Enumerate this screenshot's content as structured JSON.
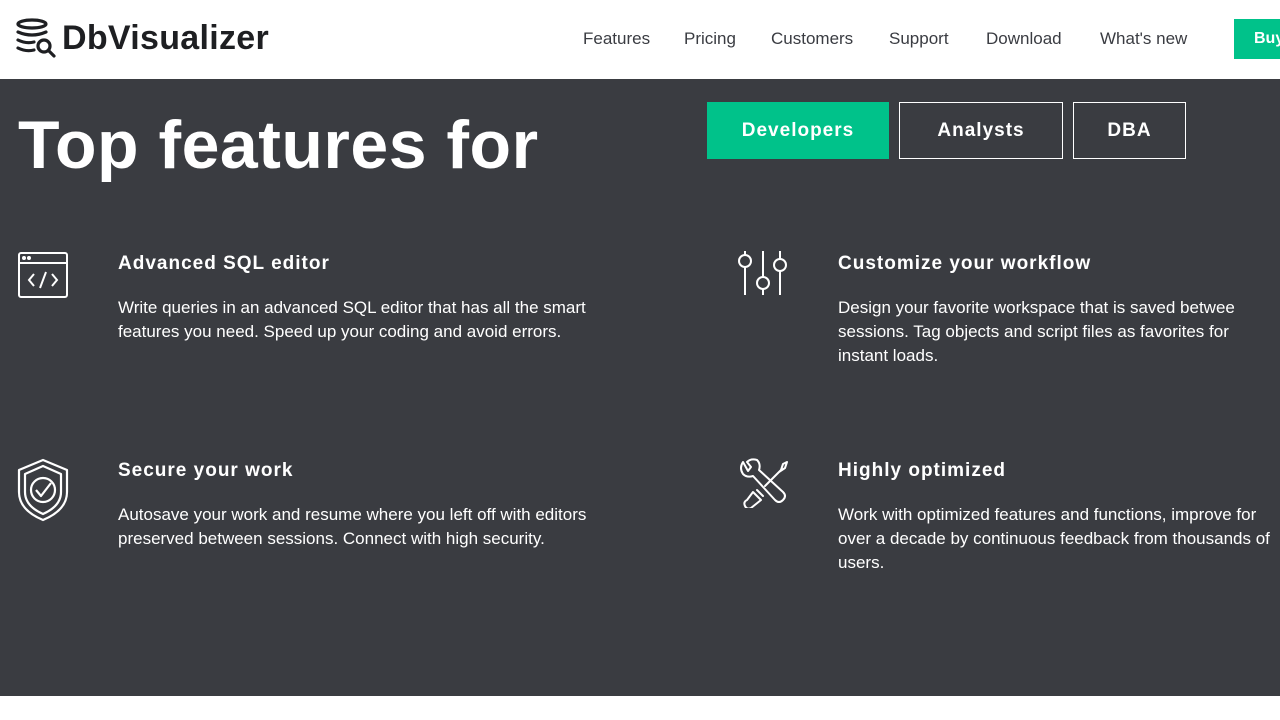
{
  "brand": {
    "name": "DbVisualizer"
  },
  "nav": {
    "items": [
      {
        "label": "Features"
      },
      {
        "label": "Pricing"
      },
      {
        "label": "Customers"
      },
      {
        "label": "Support"
      },
      {
        "label": "Download"
      },
      {
        "label": "What's new"
      }
    ],
    "buy_label": "Buy"
  },
  "hero": {
    "title": "Top features for",
    "tabs": [
      {
        "label": "Developers",
        "active": true
      },
      {
        "label": "Analysts",
        "active": false
      },
      {
        "label": "DBA",
        "active": false
      }
    ]
  },
  "features": [
    {
      "icon": "code-window-icon",
      "title": "Advanced SQL editor",
      "description": "Write queries in an advanced SQL editor that has all the smart features you need. Speed up your coding and avoid errors."
    },
    {
      "icon": "sliders-icon",
      "title": "Customize your workflow",
      "description": "Design your favorite workspace that is saved betwee sessions. Tag objects and script files as favorites for instant loads."
    },
    {
      "icon": "shield-check-icon",
      "title": "Secure your work",
      "description": "Autosave your work and resume where you left off with editors preserved between sessions. Connect with high security."
    },
    {
      "icon": "tools-icon",
      "title": "Highly optimized",
      "description": "Work with optimized features and functions, improve for over a decade by continuous feedback from thousands of users."
    }
  ],
  "colors": {
    "accent": "#00c28a",
    "section_background": "#3a3c41",
    "text_dark": "#1e1f22"
  }
}
